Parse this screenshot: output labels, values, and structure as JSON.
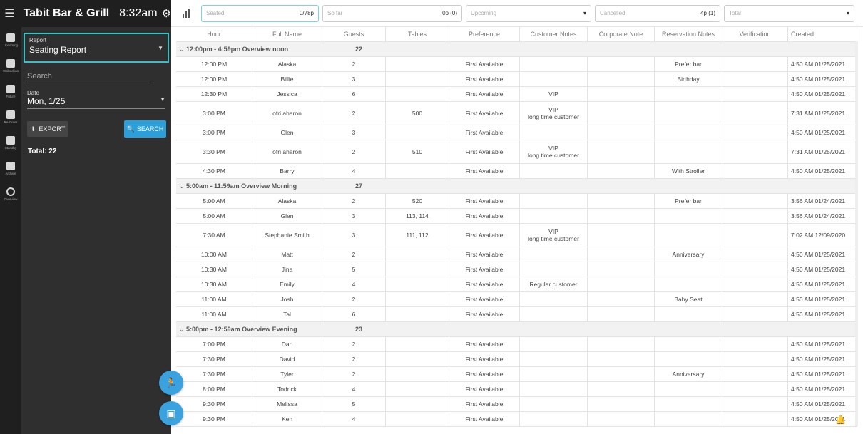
{
  "header": {
    "title": "Tabit Bar & Grill",
    "time": "8:32am"
  },
  "rail": [
    {
      "icon": "menu-icon",
      "label": "Upcoming"
    },
    {
      "icon": "clipboard-icon",
      "label": "Walked-ins"
    },
    {
      "icon": "calendar-icon",
      "label": "Future"
    },
    {
      "icon": "clipboard-icon",
      "label": "Re-Order"
    },
    {
      "icon": "people-icon",
      "label": "Standby"
    },
    {
      "icon": "briefcase-icon",
      "label": "Archive"
    },
    {
      "icon": "clock-icon",
      "label": "Overview"
    }
  ],
  "panel": {
    "report_label": "Report",
    "report_value": "Seating Report",
    "search_placeholder": "Search",
    "date_label": "Date",
    "date_value": "Mon, 1/25",
    "export_label": "EXPORT",
    "search_label": "SEARCH",
    "total": "Total: 22"
  },
  "stats": [
    {
      "placeholder": "Seated",
      "value": "0/78p"
    },
    {
      "placeholder": "So far",
      "value": "0p (0)"
    },
    {
      "placeholder": "Upcoming",
      "value": ""
    },
    {
      "placeholder": "Cancelled",
      "value": "4p (1)"
    },
    {
      "placeholder": "Total",
      "value": ""
    }
  ],
  "columns": [
    "Hour",
    "Full Name",
    "Guests",
    "Tables",
    "Preference",
    "Customer Notes",
    "Corporate Note",
    "Reservation Notes",
    "Verification",
    "Created"
  ],
  "groups": [
    {
      "label": "12:00pm - 4:59pm Overview noon",
      "count": "22",
      "rows": [
        [
          "12:00 PM",
          "Alaska",
          "2",
          "",
          "First Available",
          "",
          "",
          "Prefer bar",
          "",
          "4:50 AM 01/25/2021"
        ],
        [
          "12:00 PM",
          "Billie",
          "3",
          "",
          "First Available",
          "",
          "",
          "Birthday",
          "",
          "4:50 AM 01/25/2021"
        ],
        [
          "12:30 PM",
          "Jessica",
          "6",
          "",
          "First Available",
          "VIP",
          "",
          "",
          "",
          "4:50 AM 01/25/2021"
        ],
        [
          "3:00 PM",
          "ofri aharon",
          "2",
          "500",
          "First Available",
          "VIP\nlong time customer",
          "",
          "",
          "",
          "7:31 AM 01/25/2021"
        ],
        [
          "3:00 PM",
          "Glen",
          "3",
          "",
          "First Available",
          "",
          "",
          "",
          "",
          "4:50 AM 01/25/2021"
        ],
        [
          "3:30 PM",
          "ofri aharon",
          "2",
          "510",
          "First Available",
          "VIP\nlong time customer",
          "",
          "",
          "",
          "7:31 AM 01/25/2021"
        ],
        [
          "4:30 PM",
          "Barry",
          "4",
          "",
          "First Available",
          "",
          "",
          "With Stroller",
          "",
          "4:50 AM 01/25/2021"
        ]
      ]
    },
    {
      "label": "5:00am - 11:59am Overview Morning",
      "count": "27",
      "rows": [
        [
          "5:00 AM",
          "Alaska",
          "2",
          "520",
          "First Available",
          "",
          "",
          "Prefer bar",
          "",
          "3:56 AM 01/24/2021"
        ],
        [
          "5:00 AM",
          "Glen",
          "3",
          "113, 114",
          "First Available",
          "",
          "",
          "",
          "",
          "3:56 AM 01/24/2021"
        ],
        [
          "7:30 AM",
          "Stephanie Smith",
          "3",
          "111, 112",
          "First Available",
          "VIP\nlong time customer",
          "",
          "",
          "",
          "7:02 AM 12/09/2020"
        ],
        [
          "10:00 AM",
          "Matt",
          "2",
          "",
          "First Available",
          "",
          "",
          "Anniversary",
          "",
          "4:50 AM 01/25/2021"
        ],
        [
          "10:30 AM",
          "Jina",
          "5",
          "",
          "First Available",
          "",
          "",
          "",
          "",
          "4:50 AM 01/25/2021"
        ],
        [
          "10:30 AM",
          "Emily",
          "4",
          "",
          "First Available",
          "Regular customer",
          "",
          "",
          "",
          "4:50 AM 01/25/2021"
        ],
        [
          "11:00 AM",
          "Josh",
          "2",
          "",
          "First Available",
          "",
          "",
          "Baby Seat",
          "",
          "4:50 AM 01/25/2021"
        ],
        [
          "11:00 AM",
          "Tal",
          "6",
          "",
          "First Available",
          "",
          "",
          "",
          "",
          "4:50 AM 01/25/2021"
        ]
      ]
    },
    {
      "label": "5:00pm - 12:59am Overview Evening",
      "count": "23",
      "rows": [
        [
          "7:00 PM",
          "Dan",
          "2",
          "",
          "First Available",
          "",
          "",
          "",
          "",
          "4:50 AM 01/25/2021"
        ],
        [
          "7:30 PM",
          "David",
          "2",
          "",
          "First Available",
          "",
          "",
          "",
          "",
          "4:50 AM 01/25/2021"
        ],
        [
          "7:30 PM",
          "Tyler",
          "2",
          "",
          "First Available",
          "",
          "",
          "Anniversary",
          "",
          "4:50 AM 01/25/2021"
        ],
        [
          "8:00 PM",
          "Todrick",
          "4",
          "",
          "First Available",
          "",
          "",
          "",
          "",
          "4:50 AM 01/25/2021"
        ],
        [
          "9:30 PM",
          "Melissa",
          "5",
          "",
          "First Available",
          "",
          "",
          "",
          "",
          "4:50 AM 01/25/2021"
        ],
        [
          "9:30 PM",
          "Ken",
          "4",
          "",
          "First Available",
          "",
          "",
          "",
          "",
          "4:50 AM 01/25/2021"
        ]
      ]
    }
  ]
}
